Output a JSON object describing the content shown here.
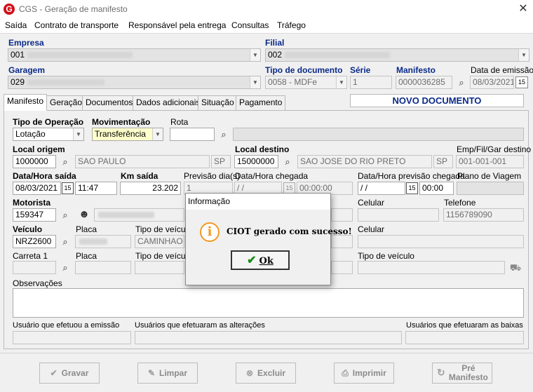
{
  "window": {
    "title": "CGS - Geração de manifesto",
    "logo": "G",
    "close": "✕"
  },
  "menu": [
    "Saída",
    "Contrato de transporte",
    "Responsável pela entrega",
    "Consultas",
    "Tráfego"
  ],
  "header": {
    "empresa_label": "Empresa",
    "empresa_value": "001",
    "filial_label": "Filial",
    "filial_value": "002",
    "garagem_label": "Garagem",
    "garagem_value": "029",
    "tipo_doc_label": "Tipo de documento",
    "tipo_doc_value": "0058 - MDFe",
    "serie_label": "Série",
    "serie_value": "1",
    "manifesto_label": "Manifesto",
    "manifesto_value": "0000036285",
    "data_emissao_label": "Data de emissão",
    "data_emissao_value": "08/03/2021"
  },
  "tabs": [
    "Manifesto",
    "Geração",
    "Documentos",
    "Dados adicionais",
    "Situação",
    "Pagamento"
  ],
  "status_banner": "NOVO DOCUMENTO",
  "form": {
    "tipo_operacao_label": "Tipo de Operação",
    "tipo_operacao_value": "Lotação",
    "movimentacao_label": "Movimentação",
    "movimentacao_value": "Transferência",
    "rota_label": "Rota",
    "local_origem_label": "Local origem",
    "local_origem_code": "1000000",
    "local_origem_city": "SAO PAULO",
    "local_origem_uf": "SP",
    "local_destino_label": "Local destino",
    "local_destino_code": "15000000",
    "local_destino_city": "SAO JOSE DO RIO PRETO",
    "local_destino_uf": "SP",
    "emp_fil_gar_label": "Emp/Fil/Gar destino",
    "emp_fil_gar_value": "001-001-001",
    "data_saida_label": "Data/Hora saída",
    "data_saida_value": "08/03/2021",
    "hora_saida_value": "11:47",
    "km_saida_label": "Km saída",
    "km_saida_value": "23.202",
    "previsao_label": "Previsão dia(s)",
    "previsao_value": "1",
    "data_chegada_label": "Data/Hora chegada",
    "data_chegada_value": "/ /",
    "hora_chegada_value": "00:00:00",
    "data_prev_chegada_label": "Data/Hora previsão chegada",
    "data_prev_chegada_value": "/ /",
    "hora_prev_chegada_value": "00:00",
    "plano_viagem_label": "Plano de Viagem",
    "motorista_label": "Motorista",
    "motorista_value": "159347",
    "celular_label": "Celular",
    "telefone_label": "Telefone",
    "telefone_value": "1156789090",
    "veiculo_label": "Veículo",
    "veiculo_value": "NRZ2600",
    "placa_label": "Placa",
    "tipo_veiculo_label": "Tipo de veículo",
    "tipo_veiculo_value": "CAMINHAO TI",
    "celular2_label": "Celular",
    "carreta_label": "Carreta 1",
    "placa2_label": "Placa",
    "tipo_veiculo2_label": "Tipo de veículo",
    "tipo_veiculo3_label": "Tipo de veículo",
    "observacoes_label": "Observações",
    "usuario_emissao_label": "Usuário que efetuou a emissão",
    "usuarios_alteracoes_label": "Usuários que efetuaram as alterações",
    "usuarios_baixas_label": "Usuários que efetuaram as baixas"
  },
  "dialog": {
    "title": "Informação",
    "message": "CIOT gerado com sucesso!",
    "ok_label": "Ok",
    "icon": "info-icon"
  },
  "actions": {
    "gravar": "Gravar",
    "limpar": "Limpar",
    "excluir": "Excluir",
    "imprimir": "Imprimir",
    "pre_manifesto_1": "Pré",
    "pre_manifesto_2": "Manifesto"
  }
}
